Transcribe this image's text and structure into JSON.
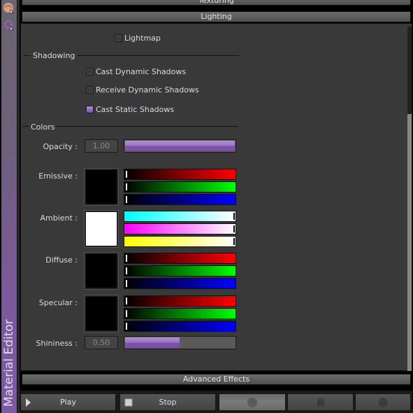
{
  "sidebar": {
    "title": "Material Editor",
    "icons": [
      "material-sphere-icon",
      "gear-settings-icon"
    ]
  },
  "sections": {
    "texturing": "Texturing",
    "lighting": "Lighting",
    "advanced": "Advanced Effects"
  },
  "lighting": {
    "lightmap": {
      "label": "Lightmap",
      "checked": false
    }
  },
  "shadowing": {
    "title": "Shadowing",
    "options": [
      {
        "label": "Cast Dynamic Shadows",
        "checked": false
      },
      {
        "label": "Receive Dynamic Shadows",
        "checked": false
      },
      {
        "label": "Cast Static Shadows",
        "checked": true
      }
    ]
  },
  "colors": {
    "title": "Colors",
    "opacity": {
      "label": "Opacity :",
      "value": "1.00",
      "fraction": 1.0
    },
    "emissive": {
      "label": "Emissive :",
      "color": "#000000",
      "rgb": [
        0,
        0,
        0
      ]
    },
    "ambient": {
      "label": "Ambient :",
      "color": "#ffffff",
      "rgb": [
        255,
        255,
        255
      ]
    },
    "diffuse": {
      "label": "Diffuse :",
      "color": "#000000",
      "rgb": [
        0,
        0,
        0
      ]
    },
    "specular": {
      "label": "Specular :",
      "color": "#000000",
      "rgb": [
        0,
        0,
        0
      ]
    },
    "shininess": {
      "label": "Shininess :",
      "value": "0.50",
      "fraction": 0.5
    }
  },
  "toolbar": {
    "play_label": "Play",
    "stop_label": "Stop",
    "preview_shapes": [
      "sphere",
      "cylinder",
      "cube"
    ],
    "selected_shape": "sphere"
  },
  "theme": {
    "accent": "#8a62b8"
  }
}
